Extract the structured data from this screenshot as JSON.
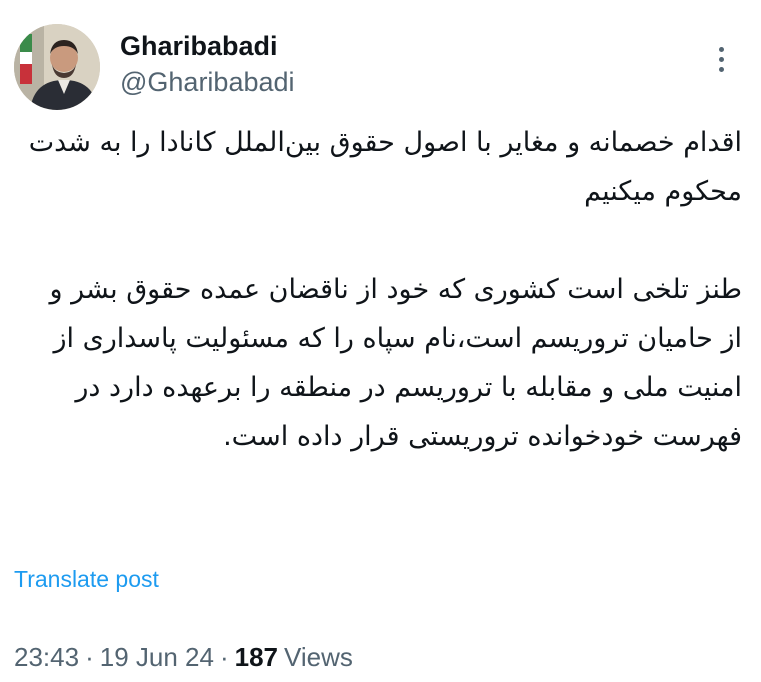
{
  "author": {
    "display_name": "Gharibabadi",
    "handle": "@Gharibabadi"
  },
  "more_icon": "more-horizontal-icon",
  "post": {
    "paragraph_1": "اقدام خصمانه و مغایر با اصول حقوق بین‌الملل کانادا را به شدت محکوم میکنیم",
    "paragraph_2": "طنز تلخی است کشوری که خود از ناقضان عمده حقوق بشر و از حامیان تروریسم است،نام سپاه را که مسئولیت پاسداری از امنیت ملی و مقابله با تروریسم در منطقه را برعهده دارد در فهرست خودخوانده تروریستی قرار داده است."
  },
  "translate_label": "Translate post",
  "meta": {
    "time": "23:43",
    "date": "19 Jun 24",
    "views_count": "187",
    "views_label": "Views",
    "separator": "·"
  },
  "colors": {
    "text": "#0f1419",
    "secondary": "#536471",
    "link": "#1d9bf0"
  }
}
